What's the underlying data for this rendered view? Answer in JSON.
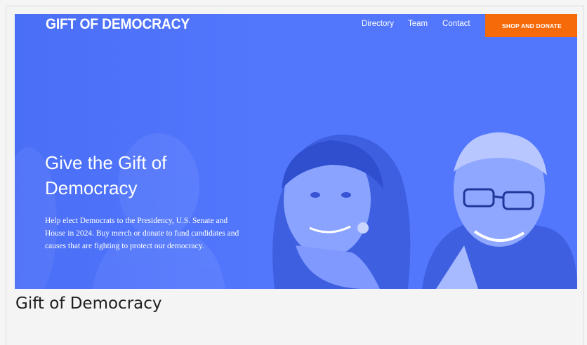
{
  "site": {
    "logo": "GIFT OF DEMOCRACY",
    "nav": [
      {
        "label": "Directory"
      },
      {
        "label": "Team"
      },
      {
        "label": "Contact"
      }
    ],
    "cta_label": "SHOP AND DONATE"
  },
  "hero": {
    "headline": "Give the Gift of Democracy",
    "blurb": "Help elect Democrats to the Presidency, U.S. Senate and House in 2024. Buy merch or donate to fund candidates and causes that are fighting to protect our democracy.",
    "image": "photo-of-candidates"
  },
  "caption": "Gift of Democracy",
  "colors": {
    "hero_blue": "#5277fd",
    "cta_orange": "#f66a0a",
    "page_bg": "#f4f4f4"
  }
}
